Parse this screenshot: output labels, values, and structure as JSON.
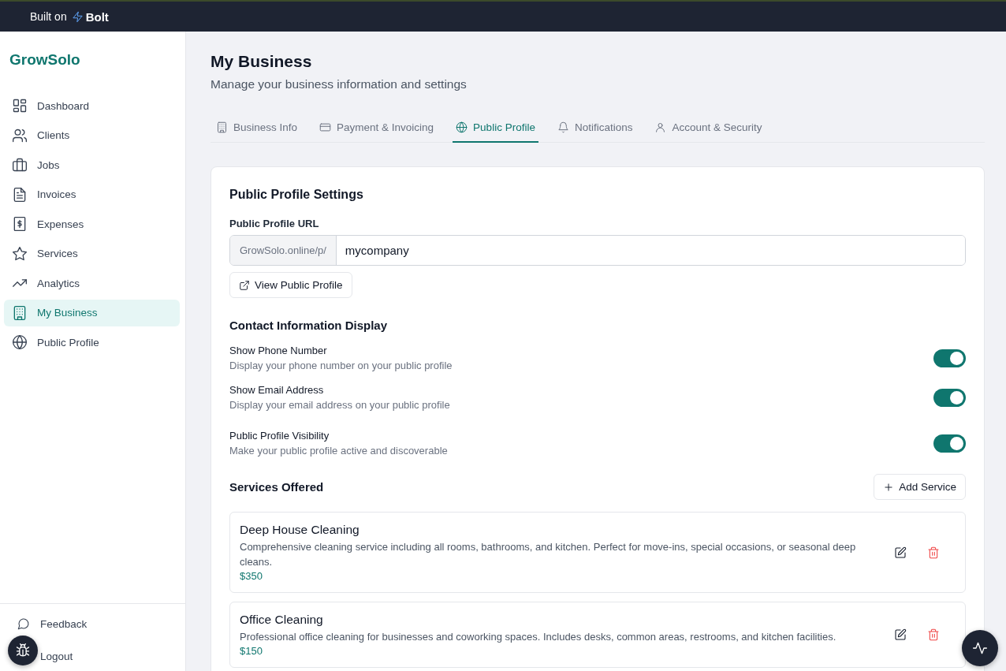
{
  "topbar": {
    "prefix": "Built on",
    "brand": "Bolt"
  },
  "sidebar": {
    "logo": "GrowSolo",
    "items": [
      {
        "label": "Dashboard",
        "selected": false
      },
      {
        "label": "Clients",
        "selected": false
      },
      {
        "label": "Jobs",
        "selected": false
      },
      {
        "label": "Invoices",
        "selected": false
      },
      {
        "label": "Expenses",
        "selected": false
      },
      {
        "label": "Services",
        "selected": false
      },
      {
        "label": "Analytics",
        "selected": false
      },
      {
        "label": "My Business",
        "selected": true
      },
      {
        "label": "Public Profile",
        "selected": false
      }
    ],
    "footer": [
      "Feedback",
      "Logout"
    ]
  },
  "page": {
    "title": "My Business",
    "subtitle": "Manage your business information and settings"
  },
  "tabs": [
    {
      "label": "Business Info",
      "selected": false
    },
    {
      "label": "Payment & Invoicing",
      "selected": false
    },
    {
      "label": "Public Profile",
      "selected": true
    },
    {
      "label": "Notifications",
      "selected": false
    },
    {
      "label": "Account & Security",
      "selected": false
    }
  ],
  "card": {
    "title": "Public Profile Settings",
    "url": {
      "label": "Public Profile URL",
      "prefix": "GrowSolo.online/p/",
      "value": "mycompany"
    },
    "view_button": "View Public Profile",
    "contact_heading": "Contact Information Display",
    "toggles": [
      {
        "title": "Show Phone Number",
        "description": "Display your phone number on your public profile",
        "on": true
      },
      {
        "title": "Show Email Address",
        "description": "Display your email address on your public profile",
        "on": true
      },
      {
        "title": "Public Profile Visibility",
        "description": "Make your public profile active and discoverable",
        "on": true
      }
    ],
    "services_heading": "Services Offered",
    "add_button": "Add Service",
    "services": [
      {
        "name": "Deep House Cleaning",
        "description": "Comprehensive cleaning service including all rooms, bathrooms, and kitchen. Perfect for move-ins, special occasions, or seasonal deep cleans.",
        "price": "$350"
      },
      {
        "name": "Office Cleaning",
        "description": "Professional office cleaning for businesses and coworking spaces. Includes desks, common areas, restrooms, and kitchen facilities.",
        "price": "$150"
      }
    ]
  }
}
